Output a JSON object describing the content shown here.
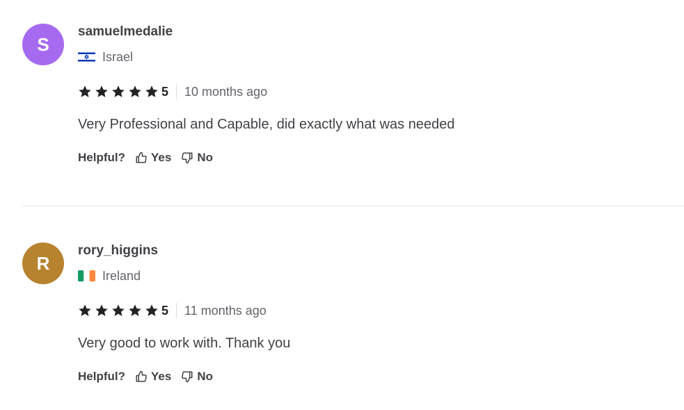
{
  "reviews": [
    {
      "avatar_letter": "S",
      "avatar_color": "#a66af0",
      "username": "samuelmedalie",
      "country": "Israel",
      "flag": "israel-flag",
      "stars": 5,
      "rating": "5",
      "time": "10 months ago",
      "text": "Very Professional and Capable, did exactly what was needed",
      "helpful_label": "Helpful?",
      "yes_label": "Yes",
      "no_label": "No"
    },
    {
      "avatar_letter": "R",
      "avatar_color": "#b8832f",
      "username": "rory_higgins",
      "country": "Ireland",
      "flag": "ireland-flag",
      "stars": 5,
      "rating": "5",
      "time": "11 months ago",
      "text": "Very good to work with. Thank you",
      "helpful_label": "Helpful?",
      "yes_label": "Yes",
      "no_label": "No"
    }
  ]
}
